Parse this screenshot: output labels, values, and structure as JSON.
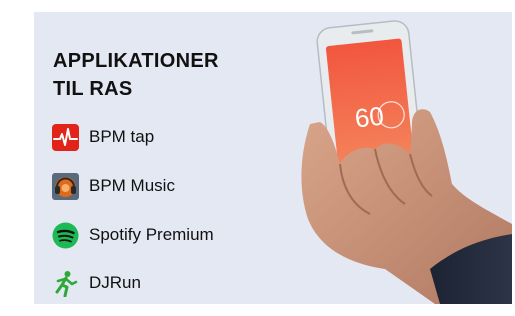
{
  "heading": {
    "line1": "APPLIKATIONER",
    "line2": "TIL RAS"
  },
  "apps": [
    {
      "label": "BPM tap",
      "icon": "heartbeat-icon",
      "color": "#e2231a"
    },
    {
      "label": "BPM Music",
      "icon": "dj-headphones-icon",
      "color": "#e06a1a"
    },
    {
      "label": "Spotify Premium",
      "icon": "spotify-icon",
      "color": "#1db954"
    },
    {
      "label": "DJRun",
      "icon": "running-man-icon",
      "color": "#2fa83a"
    }
  ],
  "phone": {
    "display_value": "60",
    "screen_color": "#f06a4e"
  }
}
